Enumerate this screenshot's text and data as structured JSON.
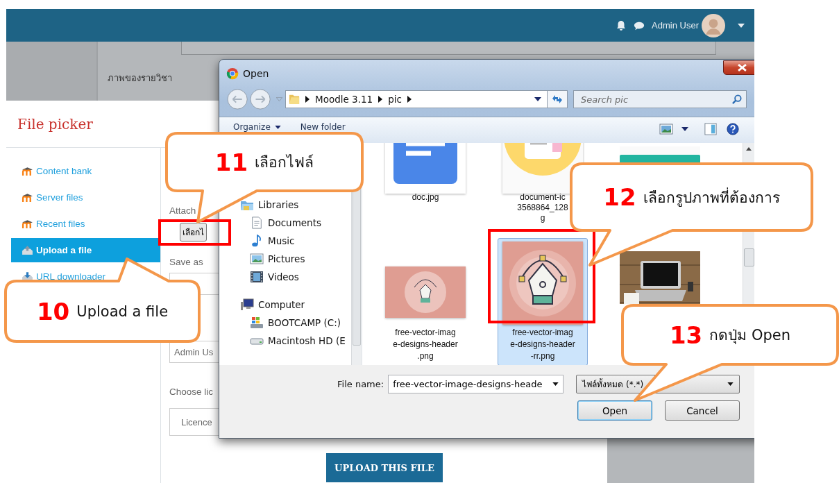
{
  "top_bar": {
    "user_name": "Admin User"
  },
  "background_page": {
    "image_label": "ภาพของรายวิชา"
  },
  "file_picker": {
    "title": "File picker",
    "repositories": [
      {
        "label": "Content bank",
        "kind": "moodle",
        "selected": false
      },
      {
        "label": "Server files",
        "kind": "moodle",
        "selected": false
      },
      {
        "label": "Recent files",
        "kind": "moodle",
        "selected": false
      },
      {
        "label": "Upload a file",
        "kind": "upload",
        "selected": true
      },
      {
        "label": "URL downloader",
        "kind": "url",
        "selected": false
      }
    ],
    "form": {
      "attach_label": "Attach",
      "choose_button": "เลือกไ",
      "save_as_label": "Save as",
      "author_value": "Admin Us",
      "license_label": "Choose lic",
      "license_value": "Licence",
      "upload_button": "UPLOAD THIS FILE"
    }
  },
  "open_dialog": {
    "title": "Open",
    "path": [
      "Moodle 3.11",
      "pic"
    ],
    "search": {
      "placeholder": "Search pic"
    },
    "toolbar": [
      "Organize",
      "New folder"
    ],
    "nav": [
      {
        "label": "Libraries",
        "kind": "libraries",
        "children": [
          {
            "label": "Documents",
            "kind": "documents"
          },
          {
            "label": "Music",
            "kind": "music"
          },
          {
            "label": "Pictures",
            "kind": "pictures"
          },
          {
            "label": "Videos",
            "kind": "videos"
          }
        ]
      },
      {
        "label": "Computer",
        "kind": "computer",
        "children": [
          {
            "label": "BOOTCAMP (C:)",
            "kind": "system-drive"
          },
          {
            "label": "Macintosh HD (E",
            "kind": "drive"
          }
        ]
      }
    ],
    "files": [
      {
        "kind": "doc",
        "name_lines": [
          "doc.jpg"
        ],
        "selected": false
      },
      {
        "kind": "document",
        "name_lines": [
          "document-ic",
          "3568864_128",
          "g"
        ],
        "selected": false
      },
      {
        "kind": "teal",
        "selected": false
      },
      {
        "kind": "pen-wide",
        "name_lines": [
          "free-vector-imag",
          "e-designs-header",
          ".png"
        ],
        "selected": false
      },
      {
        "kind": "pen",
        "name_lines": [
          "free-vector-imag",
          "e-designs-header",
          "-rr.png"
        ],
        "selected": true
      },
      {
        "kind": "laptop",
        "selected": false
      }
    ],
    "file_name": {
      "label": "File name:",
      "value": "free-vector-image-designs-heade"
    },
    "file_type": "ไฟล์ทั้งหมด (*.*)",
    "buttons": [
      "Open",
      "Cancel"
    ]
  },
  "callouts": [
    {
      "step": "10",
      "text": "Upload a file"
    },
    {
      "step": "11",
      "text": "เลือกไฟล์"
    },
    {
      "step": "12",
      "text": "เลือกรูปภาพที่ต้องการ"
    },
    {
      "step": "13",
      "text": "กดปุ่ม Open"
    }
  ]
}
